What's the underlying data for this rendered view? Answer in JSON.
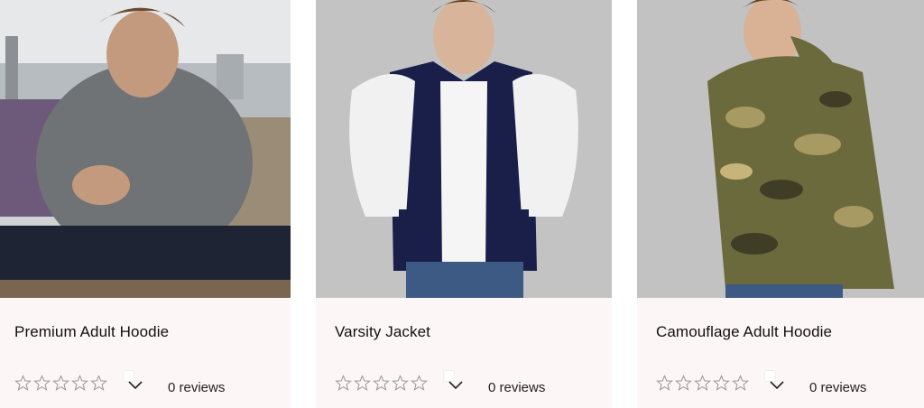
{
  "products": [
    {
      "title": "Premium Adult Hoodie",
      "reviews_label": "0 reviews",
      "rating": 0,
      "max_rating": 5,
      "image_alt": "Man in grey hoodie holding a mug"
    },
    {
      "title": "Varsity Jacket",
      "reviews_label": "0 reviews",
      "rating": 0,
      "max_rating": 5,
      "image_alt": "Man in navy and white varsity jacket"
    },
    {
      "title": "Camouflage Adult Hoodie",
      "reviews_label": "0 reviews",
      "rating": 0,
      "max_rating": 5,
      "image_alt": "Man in camouflage hoodie"
    }
  ],
  "colors": {
    "card_bg": "#fcf6f6",
    "star_outline": "#9a9a9a",
    "text": "#111111"
  }
}
